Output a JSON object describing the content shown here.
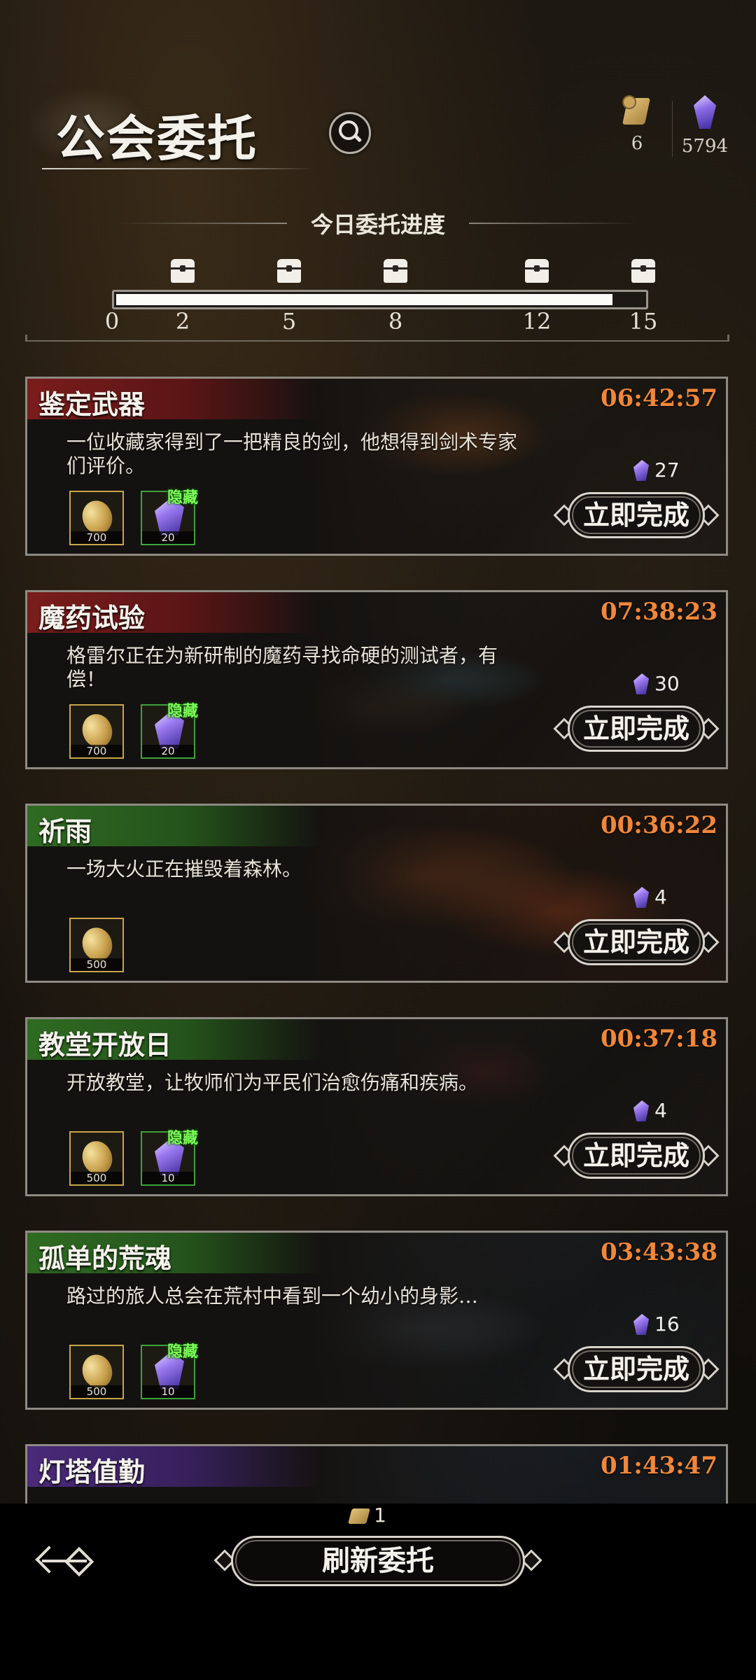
{
  "header": {
    "title": "公会委托",
    "currencies": [
      {
        "icon": "scroll-icon",
        "value": "6"
      },
      {
        "icon": "gem-icon",
        "value": "5794"
      }
    ]
  },
  "progress": {
    "title": "今日委托进度",
    "ticks": [
      "0",
      "2",
      "5",
      "8",
      "12",
      "15"
    ],
    "current_fraction": 0.94
  },
  "labels": {
    "complete": "立即完成",
    "hidden": "隐藏"
  },
  "colors": {
    "timer": "#f0873a",
    "banner_red": "#7a1c1c",
    "banner_green": "#2f6b22",
    "banner_purple": "#4a2a7a",
    "hidden_tag": "#7dfa5a"
  },
  "quests": [
    {
      "name": "鉴定武器",
      "timer": "06:42:57",
      "description": "一位收藏家得到了一把精良的剑，他想得到剑术专家们评价。",
      "cost": "27",
      "rewards": [
        {
          "type": "coin",
          "amount": "700"
        },
        {
          "type": "gem",
          "amount": "20",
          "hidden": true
        }
      ]
    },
    {
      "name": "魔药试验",
      "timer": "07:38:23",
      "description": "格雷尔正在为新研制的魔药寻找命硬的测试者，有偿！",
      "cost": "30",
      "rewards": [
        {
          "type": "coin",
          "amount": "700"
        },
        {
          "type": "gem",
          "amount": "20",
          "hidden": true
        }
      ]
    },
    {
      "name": "祈雨",
      "timer": "00:36:22",
      "description": "一场大火正在摧毁着森林。",
      "cost": "4",
      "rewards": [
        {
          "type": "coin",
          "amount": "500"
        }
      ]
    },
    {
      "name": "教堂开放日",
      "timer": "00:37:18",
      "description": "开放教堂，让牧师们为平民们治愈伤痛和疾病。",
      "cost": "4",
      "rewards": [
        {
          "type": "coin",
          "amount": "500"
        },
        {
          "type": "gem",
          "amount": "10",
          "hidden": true
        }
      ]
    },
    {
      "name": "孤单的荒魂",
      "timer": "03:43:38",
      "description": "路过的旅人总会在荒村中看到一个幼小的身影…",
      "cost": "16",
      "rewards": [
        {
          "type": "coin",
          "amount": "500"
        },
        {
          "type": "gem",
          "amount": "10",
          "hidden": true
        }
      ]
    },
    {
      "name": "灯塔值勤",
      "timer": "01:43:47"
    }
  ],
  "footer": {
    "refresh_cost": "1",
    "refresh_label": "刷新委托"
  }
}
